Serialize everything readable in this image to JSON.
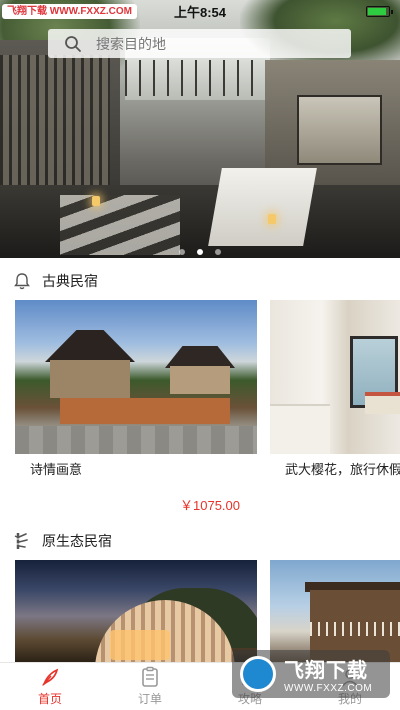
{
  "status_bar": {
    "badge": "飞翔下载 WWW.FXXZ.COM",
    "time": "上午8:54"
  },
  "search": {
    "placeholder": "搜索目的地",
    "icon": "search-icon"
  },
  "banner": {
    "slide_count": 3,
    "active_slide": 2
  },
  "sections": [
    {
      "title": "古典民宿",
      "icon": "bell-icon",
      "items": [
        {
          "name": "诗情画意",
          "price": "￥1075.00"
        },
        {
          "name": "武大樱花，旅行休假",
          "price": ""
        }
      ]
    },
    {
      "title": "原生态民宿",
      "icon": "bamboo-icon",
      "items": [
        {
          "name": "",
          "price": ""
        },
        {
          "name": "",
          "price": ""
        }
      ]
    }
  ],
  "tabbar": {
    "items": [
      {
        "label": "首页",
        "icon": "home-feather-icon",
        "active": true
      },
      {
        "label": "订单",
        "icon": "clipboard-icon",
        "active": false
      },
      {
        "label": "攻略",
        "icon": "guide-icon",
        "active": false
      },
      {
        "label": "我的",
        "icon": "profile-icon",
        "active": false
      }
    ]
  },
  "watermark": {
    "main": "飞翔下载",
    "url": "WWW.FXXZ.COM"
  },
  "colors": {
    "accent": "#e8332a",
    "tab_inactive": "#999999"
  }
}
